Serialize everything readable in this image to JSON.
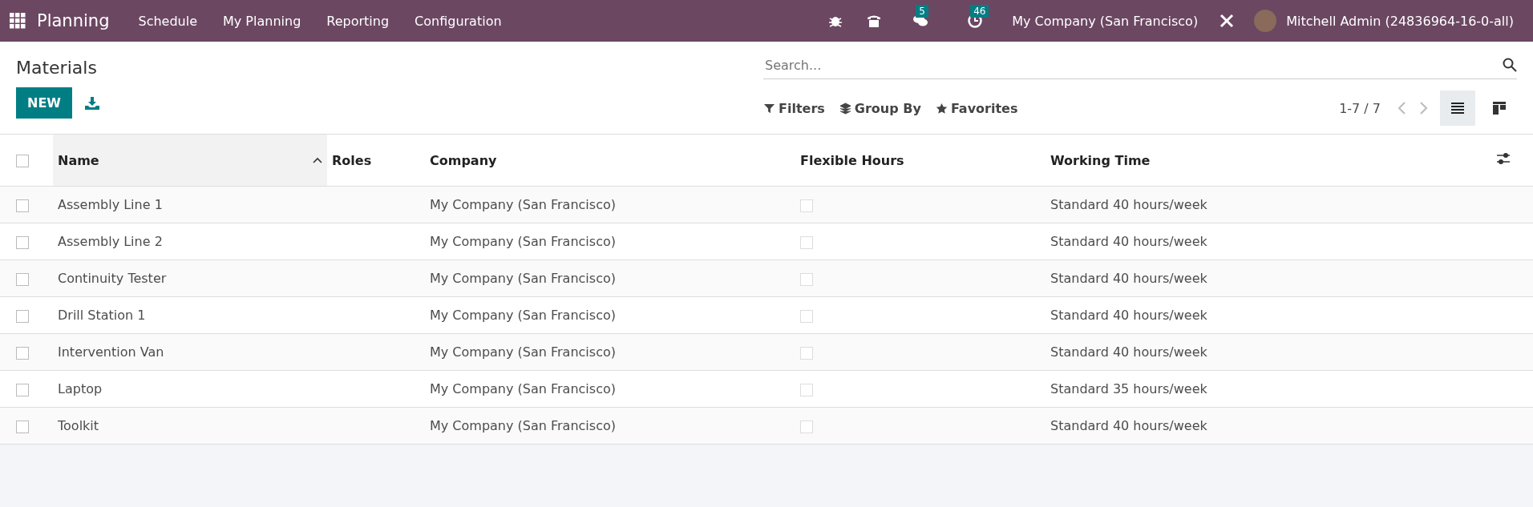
{
  "navbar": {
    "app_name": "Planning",
    "menus": [
      "Schedule",
      "My Planning",
      "Reporting",
      "Configuration"
    ],
    "messages_badge": "5",
    "activities_badge": "46",
    "company": "My Company (San Francisco)",
    "user": "Mitchell Admin (24836964-16-0-all)"
  },
  "control_panel": {
    "title": "Materials",
    "new_button": "NEW",
    "search": {
      "placeholder": "Search..."
    },
    "filters": [
      "Filters",
      "Group By",
      "Favorites"
    ],
    "pager": "1-7 / 7",
    "views": [
      {
        "kind": "list",
        "selected": true
      },
      {
        "kind": "kanban",
        "selected": false
      }
    ]
  },
  "table": {
    "select_all": false,
    "columns": [
      {
        "label": "Name",
        "sorted": true
      },
      {
        "label": "Roles",
        "sorted": false
      },
      {
        "label": "Company",
        "sorted": false
      },
      {
        "label": "Flexible Hours",
        "sorted": false
      },
      {
        "label": "Working Time",
        "sorted": false
      }
    ],
    "rows": [
      {
        "selected": false,
        "name": "Assembly Line 1",
        "company": "My Company (San Francisco)",
        "flexible_hours": false,
        "working_time": "Standard 40 hours/week"
      },
      {
        "selected": false,
        "name": "Assembly Line 2",
        "company": "My Company (San Francisco)",
        "flexible_hours": false,
        "working_time": "Standard 40 hours/week"
      },
      {
        "selected": false,
        "name": "Continuity Tester",
        "company": "My Company (San Francisco)",
        "flexible_hours": false,
        "working_time": "Standard 40 hours/week"
      },
      {
        "selected": false,
        "name": "Drill Station 1",
        "company": "My Company (San Francisco)",
        "flexible_hours": false,
        "working_time": "Standard 40 hours/week"
      },
      {
        "selected": false,
        "name": "Intervention Van",
        "company": "My Company (San Francisco)",
        "flexible_hours": false,
        "working_time": "Standard 40 hours/week"
      },
      {
        "selected": false,
        "name": "Laptop",
        "company": "My Company (San Francisco)",
        "flexible_hours": false,
        "working_time": "Standard 35 hours/week"
      },
      {
        "selected": false,
        "name": "Toolkit",
        "company": "My Company (San Francisco)",
        "flexible_hours": false,
        "working_time": "Standard 40 hours/week"
      }
    ]
  }
}
